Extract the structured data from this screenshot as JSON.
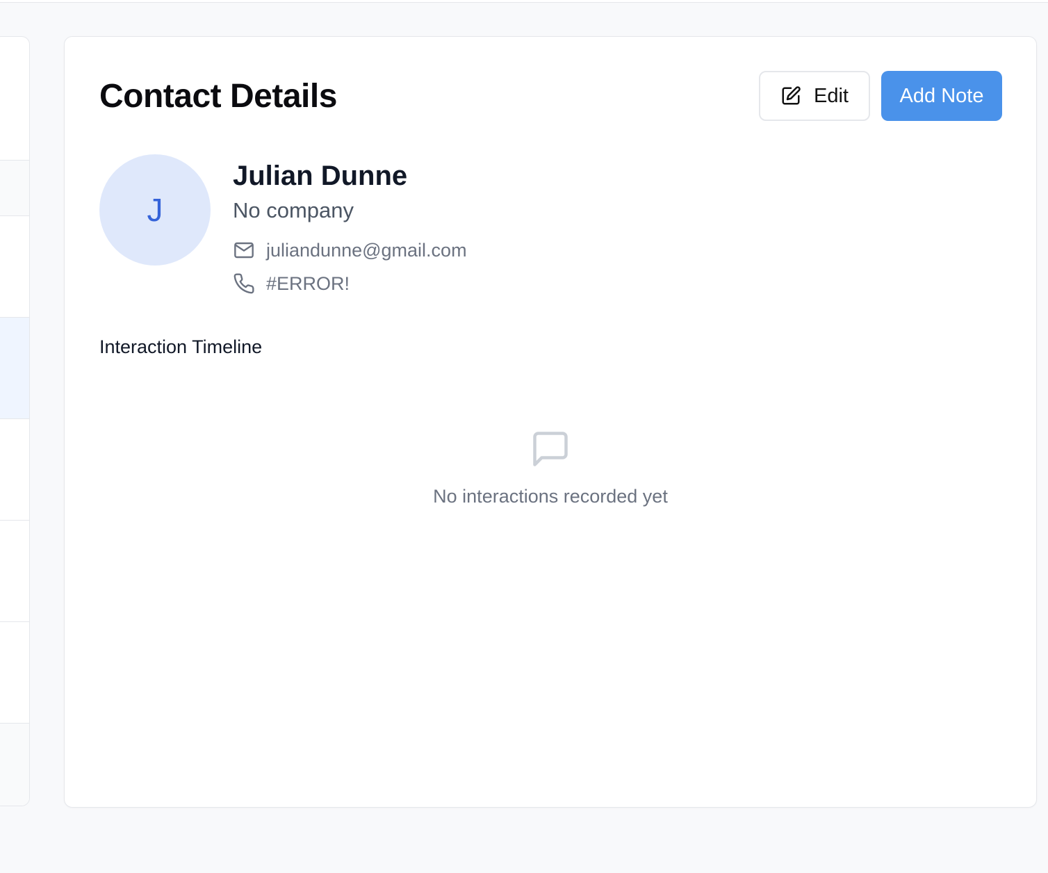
{
  "card": {
    "title": "Contact Details",
    "edit_label": "Edit",
    "add_note_label": "Add Note"
  },
  "contact": {
    "initial": "J",
    "name": "Julian Dunne",
    "company": "No company",
    "email": "juliandunne@gmail.com",
    "phone": "#ERROR!"
  },
  "timeline": {
    "title": "Interaction Timeline",
    "empty_message": "No interactions recorded yet"
  },
  "icons": {
    "edit": "edit-icon",
    "email": "mail-icon",
    "phone": "phone-icon",
    "empty": "message-square-icon"
  },
  "colors": {
    "accent": "#4a92ea",
    "avatar_bg": "#dfe8fb",
    "avatar_text": "#3563d9",
    "muted_text": "#6b7280",
    "page_bg": "#f8f9fb"
  }
}
